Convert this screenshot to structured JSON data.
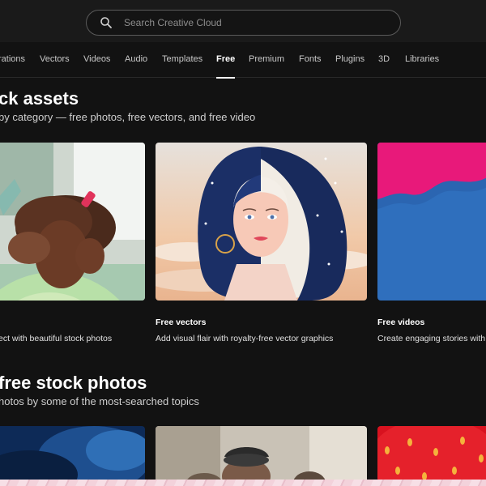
{
  "search": {
    "placeholder": "Search Creative Cloud"
  },
  "nav": {
    "items": [
      {
        "label": "rations",
        "active": false
      },
      {
        "label": "Vectors",
        "active": false
      },
      {
        "label": "Videos",
        "active": false
      },
      {
        "label": "Audio",
        "active": false
      },
      {
        "label": "Templates",
        "active": false
      },
      {
        "label": "Free",
        "active": true
      },
      {
        "label": "Premium",
        "active": false
      },
      {
        "label": "Fonts",
        "active": false
      },
      {
        "label": "Plugins",
        "active": false
      },
      {
        "label": "3D",
        "active": false
      },
      {
        "label": "Libraries",
        "active": false
      }
    ]
  },
  "section1": {
    "title": "ck assets",
    "subtitle": "by category — free photos, free vectors, and free video"
  },
  "cards": [
    {
      "label": "",
      "desc": "ect with beautiful stock photos"
    },
    {
      "label": "Free vectors",
      "desc": "Add visual flair with royalty-free vector graphics"
    },
    {
      "label": "Free videos",
      "desc": "Create engaging stories with l"
    }
  ],
  "section2": {
    "title": "free stock photos",
    "subtitle": "hotos by some of the most-searched topics"
  },
  "colors": {
    "background": "#121212",
    "topbar": "#1a1a1a",
    "accent_pink": "#e8197a",
    "video_blue": "#2f6fbd"
  }
}
